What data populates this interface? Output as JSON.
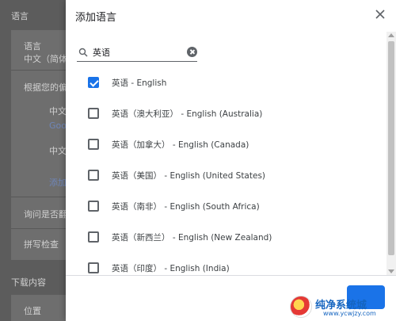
{
  "background": {
    "section_language": "语言",
    "language_title": "语言",
    "language_value": "中文（简体",
    "order_hint": "根据您的偏",
    "lang_item_1": "中文",
    "lang_item_1_sub": "Goo",
    "lang_item_2": "中文",
    "add_link": "添加",
    "ask_translate": "询问是否翻",
    "spellcheck": "拼写检查",
    "section_downloads": "下载内容",
    "location": "位置"
  },
  "dialog": {
    "title": "添加语言",
    "close_icon": "close-icon",
    "search": {
      "value": "英语",
      "icon": "search-icon",
      "clear_icon": "clear-icon"
    },
    "items": [
      {
        "label": "英语 - English",
        "checked": true
      },
      {
        "label": "英语（澳大利亚） - English (Australia)",
        "checked": false
      },
      {
        "label": "英语（加拿大） - English (Canada)",
        "checked": false
      },
      {
        "label": "英语（美国） - English (United States)",
        "checked": false
      },
      {
        "label": "英语（南非） - English (South Africa)",
        "checked": false
      },
      {
        "label": "英语（新西兰） - English (New Zealand)",
        "checked": false
      },
      {
        "label": "英语（印度） - English (India)",
        "checked": false
      }
    ]
  },
  "watermark": {
    "text": "纯净系统城",
    "url": "www.ycwjzy.com"
  },
  "colors": {
    "accent": "#1a73e8",
    "overlay": "#5c5c5c"
  }
}
